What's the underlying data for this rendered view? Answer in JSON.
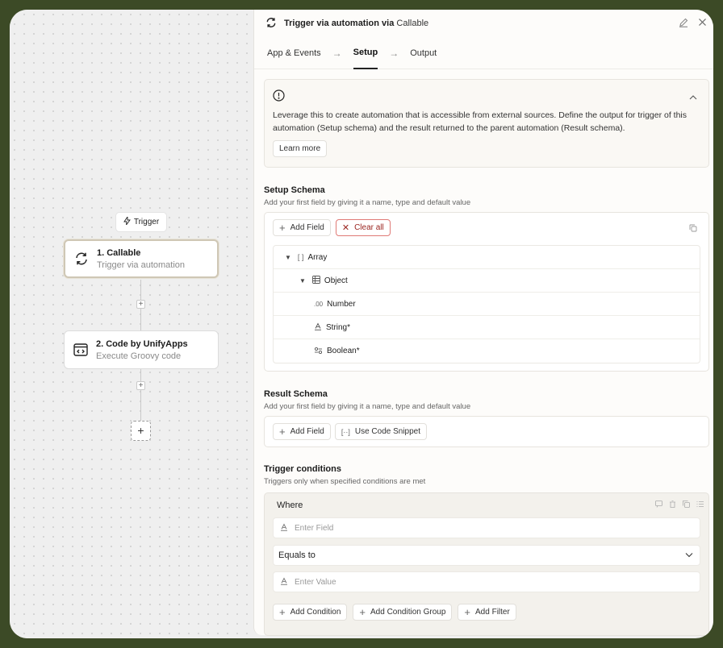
{
  "canvas": {
    "trigger_chip": "Trigger",
    "nodes": [
      {
        "title": "1. Callable",
        "subtitle": "Trigger via automation"
      },
      {
        "title": "2. Code by UnifyApps",
        "subtitle": "Execute Groovy code"
      }
    ]
  },
  "panel": {
    "title_main": "Trigger via automation via",
    "title_app": "Callable",
    "tabs": [
      {
        "label": "App & Events"
      },
      {
        "label": "Setup"
      },
      {
        "label": "Output"
      }
    ],
    "info": {
      "text": "Leverage this to create automation that is accessible from external sources. Define the output for trigger of this automation (Setup schema) and the result returned to the parent automation (Result schema).",
      "learn_more": "Learn more"
    },
    "setup_schema": {
      "title": "Setup Schema",
      "subtitle": "Add your first field by giving it a name, type and default value",
      "add_field": "Add Field",
      "clear_all": "Clear all",
      "rows": [
        {
          "icon_text": "[ ]",
          "label": "Array"
        },
        {
          "label": "Object"
        },
        {
          "icon_text": ".00",
          "label": "Number"
        },
        {
          "label": "String*"
        },
        {
          "label": "Boolean*"
        }
      ]
    },
    "result_schema": {
      "title": "Result Schema",
      "subtitle": "Add your first field by giving it a name, type and default value",
      "add_field": "Add Field",
      "use_snippet": "Use Code Snippet"
    },
    "trigger_conditions": {
      "title": "Trigger conditions",
      "subtitle": "Triggers only when specified conditions are met",
      "where": "Where",
      "field_placeholder": "Enter Field",
      "operator": "Equals to",
      "value_placeholder": "Enter Value",
      "add_condition": "Add Condition",
      "add_condition_group": "Add Condition Group",
      "add_filter": "Add Filter"
    }
  }
}
